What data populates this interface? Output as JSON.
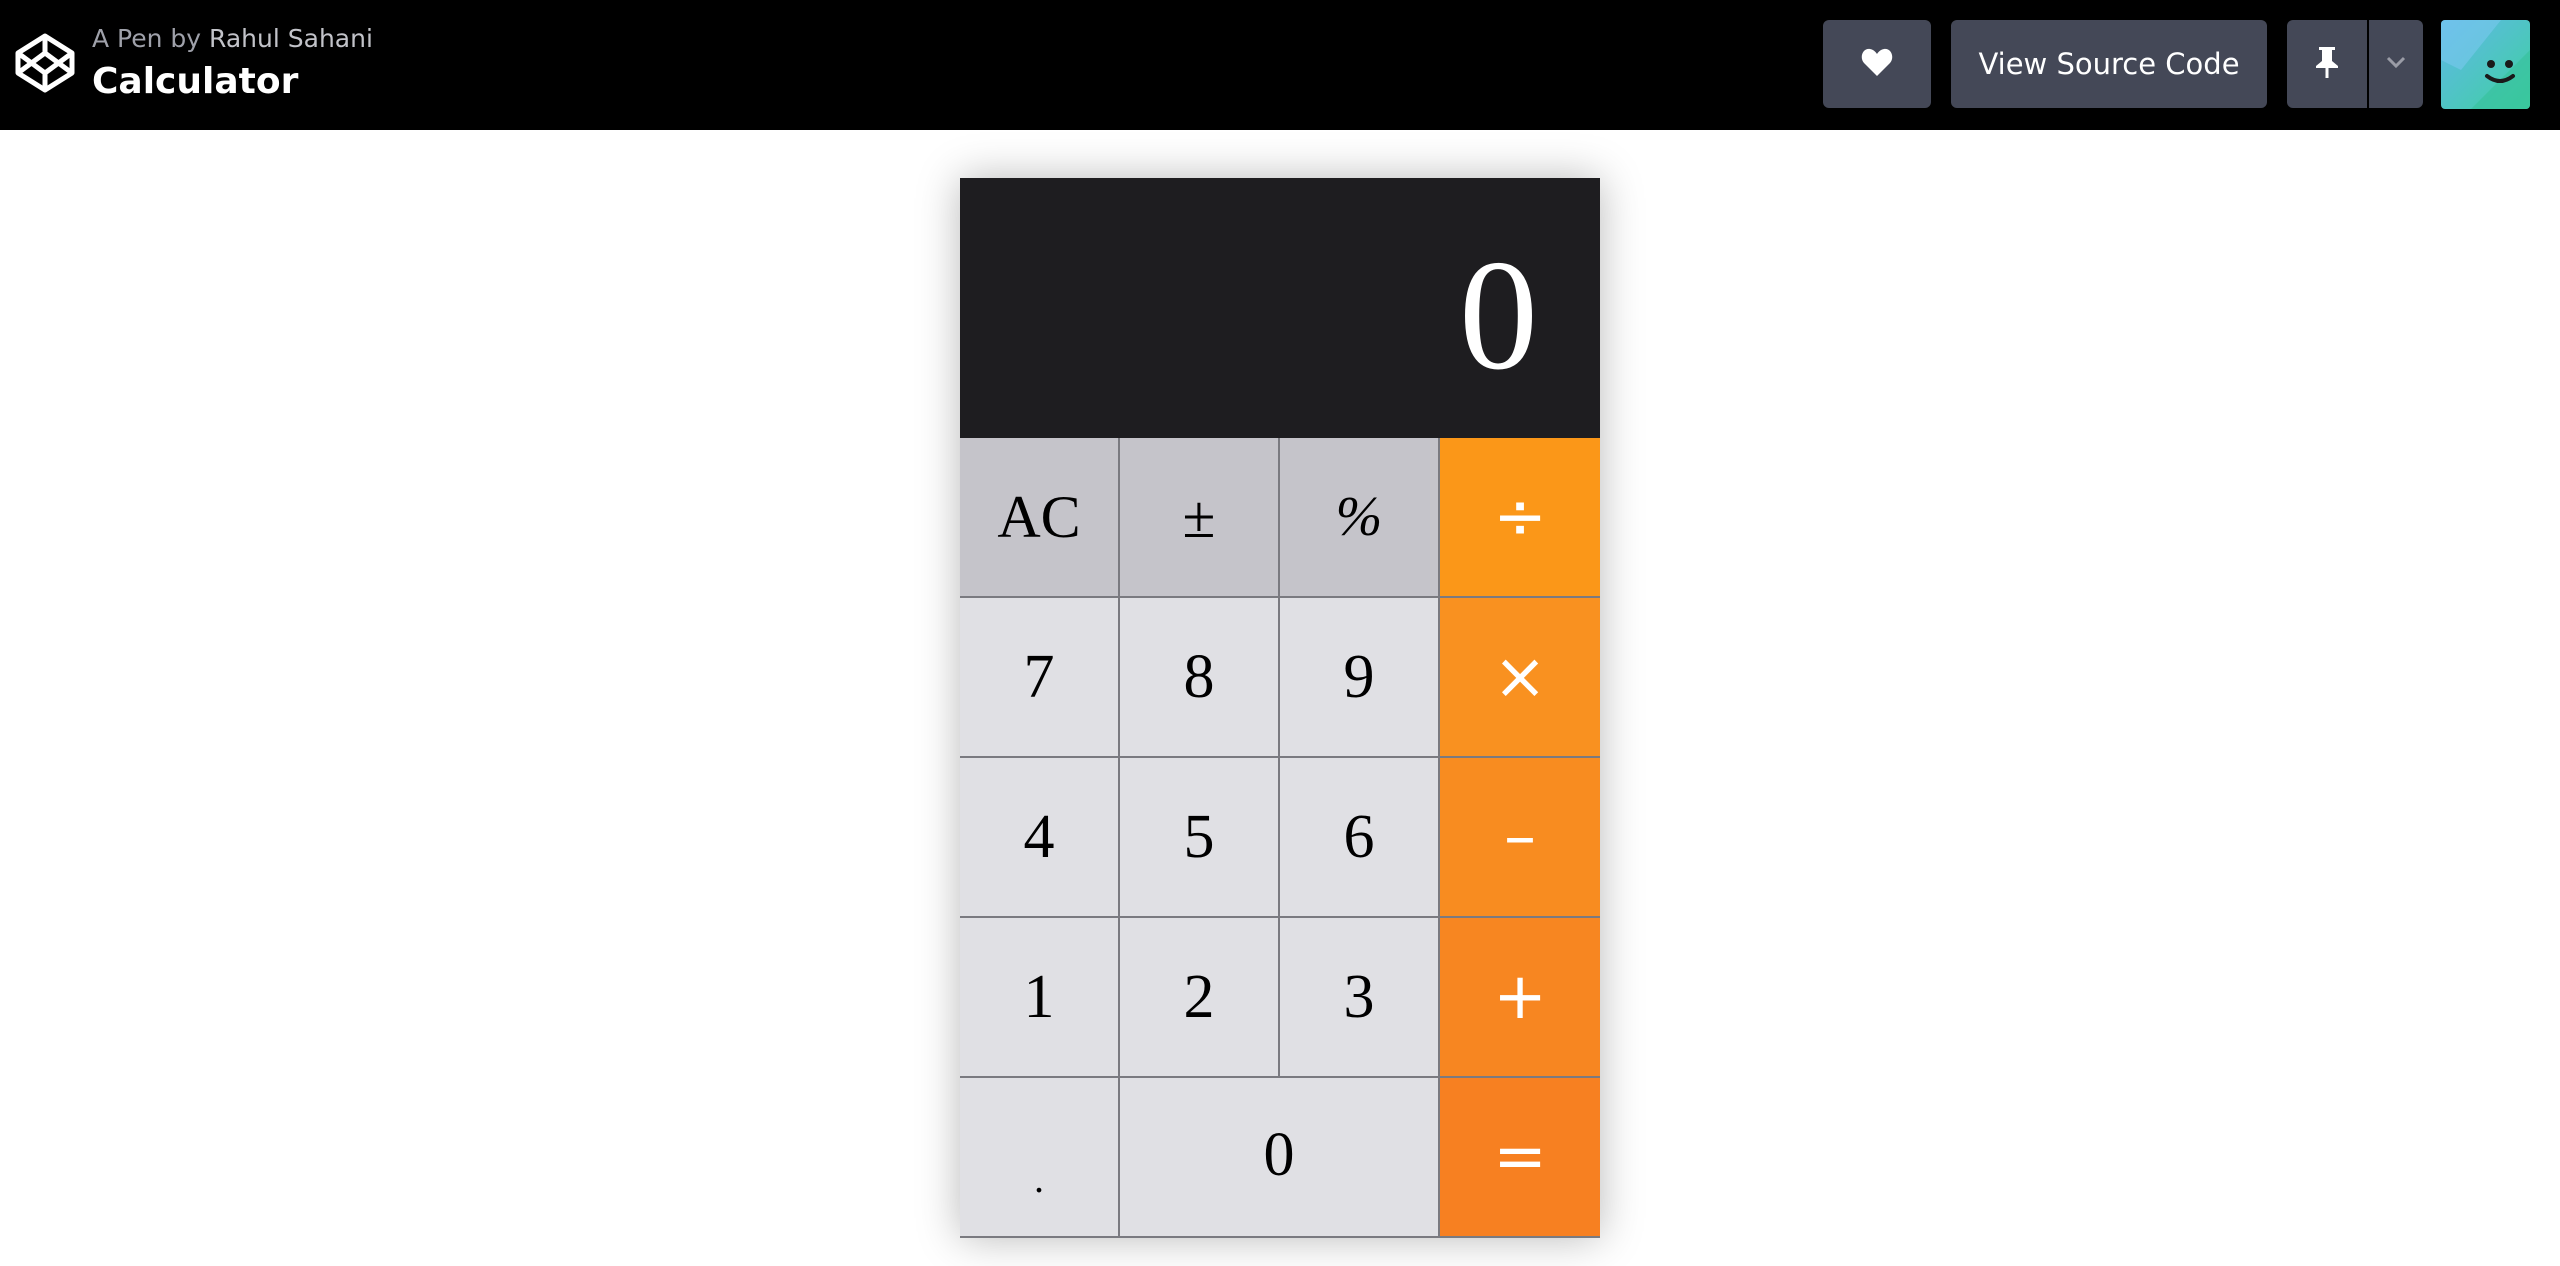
{
  "header": {
    "pen_prefix": "A Pen by",
    "author": "Rahul Sahani",
    "title": "Calculator",
    "logo_icon": "codepen-logo-icon",
    "heart_icon": "heart-icon",
    "source_button_label": "View Source Code",
    "pin_icon": "pin-icon",
    "caret_icon": "chevron-down-icon",
    "avatar": "user-avatar"
  },
  "calculator": {
    "display_value": "0",
    "keys": {
      "clear": "AC",
      "sign": "±",
      "percent": "%",
      "divide": "÷",
      "seven": "7",
      "eight": "8",
      "nine": "9",
      "multiply": "×",
      "four": "4",
      "five": "5",
      "six": "6",
      "subtract": "–",
      "one": "1",
      "two": "2",
      "three": "3",
      "add": "+",
      "decimal": ".",
      "zero": "0",
      "equals": "="
    },
    "colors": {
      "display_bg": "#1e1d20",
      "function_key": "#c5c4ca",
      "number_key": "#e0e0e4",
      "operator_key": "#fb9718"
    }
  }
}
